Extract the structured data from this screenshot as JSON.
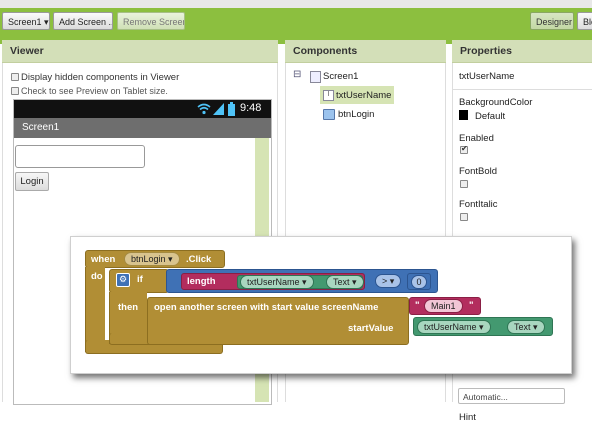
{
  "toolbar": {
    "screen_selector": "Screen1 ▾",
    "add_screen": "Add Screen ...",
    "remove_screen": "Remove Screen",
    "designer": "Designer",
    "blocks_partial": "Blo"
  },
  "viewer": {
    "title": "Viewer",
    "display_hidden": "Display hidden components in Viewer",
    "tablet_preview": "Check to see Preview on Tablet size.",
    "status_time": "9:48",
    "screen_title": "Screen1",
    "login_button": "Login"
  },
  "components": {
    "title": "Components",
    "tree": {
      "collapse": "⊟",
      "root": "Screen1",
      "items": [
        "txtUserName",
        "btnLogin"
      ]
    }
  },
  "properties": {
    "title": "Properties",
    "component_name": "txtUserName",
    "bg_color_label": "BackgroundColor",
    "bg_color_value": "Default",
    "enabled_label": "Enabled",
    "font_bold_label": "FontBold",
    "font_italic_label": "FontItalic",
    "automatic_value": "Automatic...",
    "hint_label": "Hint"
  },
  "blocks": {
    "when": "when",
    "component": "btnLogin",
    "event": ".Click",
    "do": "do",
    "if": "if",
    "length": "length",
    "textbox": "txtUserName",
    "text_prop": "Text",
    "comparison": ">",
    "number": "0",
    "then": "then",
    "open_screen": "open another screen with start value  screenName",
    "screen_name_value": "Main1",
    "start_value": "startValue",
    "quote_open": "\"",
    "quote_close": "\""
  },
  "colors": {
    "toolbar_green": "#8cbf3f",
    "event_block": "#b18e35",
    "control_block": "#b18e35",
    "math_block": "#3f71b5",
    "text_block": "#b32d5e",
    "component_block": "#439970",
    "screen_block": "#b18e35"
  }
}
